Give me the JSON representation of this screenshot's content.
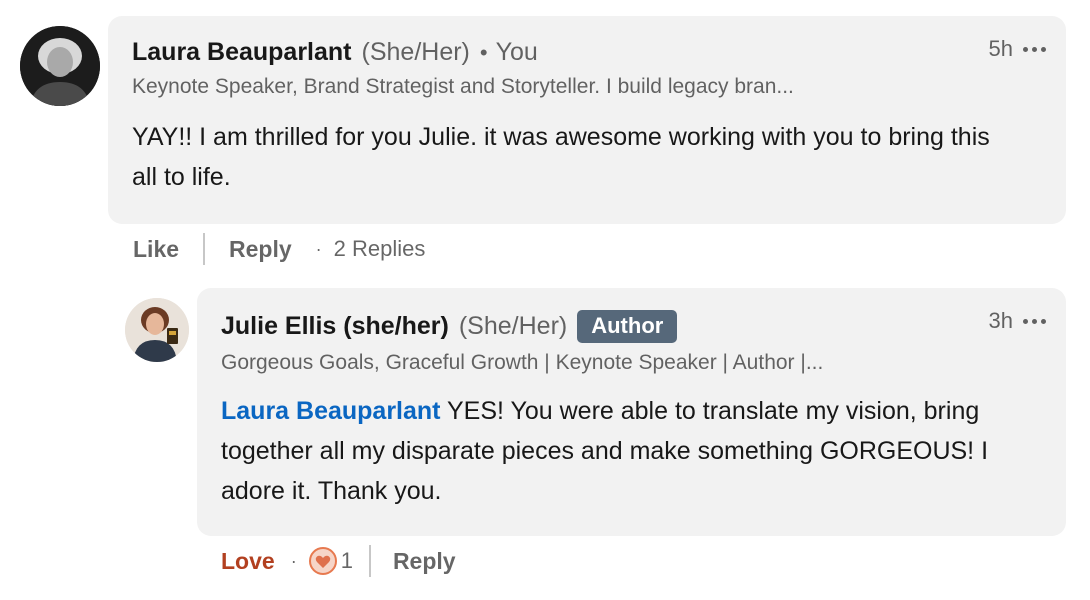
{
  "comment": {
    "author_name": "Laura Beauparlant",
    "pronouns": "(She/Her)",
    "separator": "•",
    "you_label": "You",
    "headline": "Keynote Speaker, Brand Strategist and Storyteller. I build legacy bran...",
    "time": "5h",
    "text": "YAY!! I am thrilled for you Julie. it was awesome working with you to bring this all to life.",
    "actions": {
      "like_label": "Like",
      "reply_label": "Reply",
      "dot": "·",
      "replies_label": "2 Replies"
    }
  },
  "reply": {
    "author_name": "Julie Ellis (she/her)",
    "pronouns": "(She/Her)",
    "badge": "Author",
    "headline": "Gorgeous Goals, Graceful Growth | Keynote Speaker | Author |...",
    "time": "3h",
    "mention": "Laura Beauparlant",
    "text": " YES! You were able to translate my vision, bring together all my disparate pieces and make something GORGEOUS! I adore it. Thank you.",
    "actions": {
      "reaction_label": "Love",
      "dot": "·",
      "reaction_count": "1",
      "reply_label": "Reply"
    }
  },
  "icons": {
    "more": "ellipsis-icon",
    "love_reaction": "heart-reaction-icon"
  },
  "colors": {
    "bubble_bg": "#f2f2f2",
    "mention": "#0a66c2",
    "author_badge_bg": "#56687a",
    "love_text": "#b24020",
    "love_icon": "#e7794f"
  }
}
